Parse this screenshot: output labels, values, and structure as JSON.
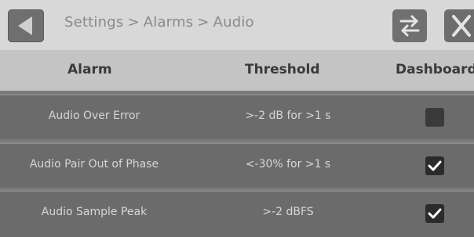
{
  "breadcrumb": [
    "Settings",
    "Alarms",
    "Audio"
  ],
  "breadcrumb_separator": ">",
  "columns": {
    "alarm": "Alarm",
    "threshold": "Threshold",
    "dashboard": "Dashboard"
  },
  "rows": [
    {
      "name": "Audio Over Error",
      "threshold": ">-2 dB for >1 s",
      "dashboard": false
    },
    {
      "name": "Audio Pair Out of Phase",
      "threshold": "<-30% for >1 s",
      "dashboard": true
    },
    {
      "name": "Audio Sample Peak",
      "threshold": ">-2 dBFS",
      "dashboard": true
    }
  ],
  "icons": {
    "back": "back-arrow-icon",
    "swap": "swap-arrows-icon",
    "close": "close-icon",
    "check": "checkmark-icon"
  }
}
